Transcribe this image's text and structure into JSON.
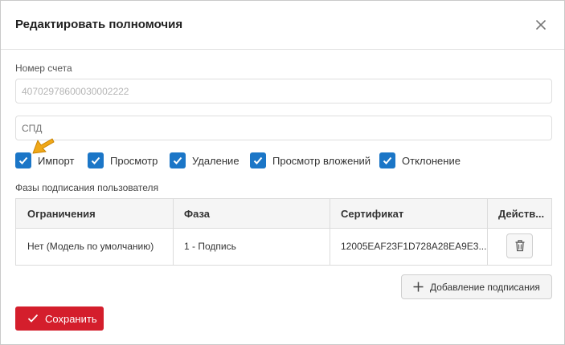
{
  "dialog": {
    "title": "Редактировать полномочия",
    "close_icon": "close-icon"
  },
  "form": {
    "account_label": "Номер счета",
    "account_value": "40702978600030002222",
    "spd_placeholder": "СПД"
  },
  "checkboxes": [
    {
      "label": "Импорт",
      "checked": true
    },
    {
      "label": "Просмотр",
      "checked": true
    },
    {
      "label": "Удаление",
      "checked": true
    },
    {
      "label": "Просмотр вложений",
      "checked": true
    },
    {
      "label": "Отклонение",
      "checked": true
    }
  ],
  "phases": {
    "title": "Фазы подписания пользователя",
    "columns": [
      "Ограничения",
      "Фаза",
      "Сертификат",
      "Действ..."
    ],
    "rows": [
      {
        "restriction": "Нет (Модель по умолчанию)",
        "phase": "1 - Подпись",
        "certificate": "12005EAF23F1D728A28EA9E3...",
        "action_icon": "trash-icon"
      }
    ]
  },
  "buttons": {
    "add_signing": "Добавление подписания",
    "save": "Сохранить"
  },
  "colors": {
    "checkbox": "#1b76c7",
    "save_button": "#d41e2c",
    "cursor": "#f0a818"
  }
}
